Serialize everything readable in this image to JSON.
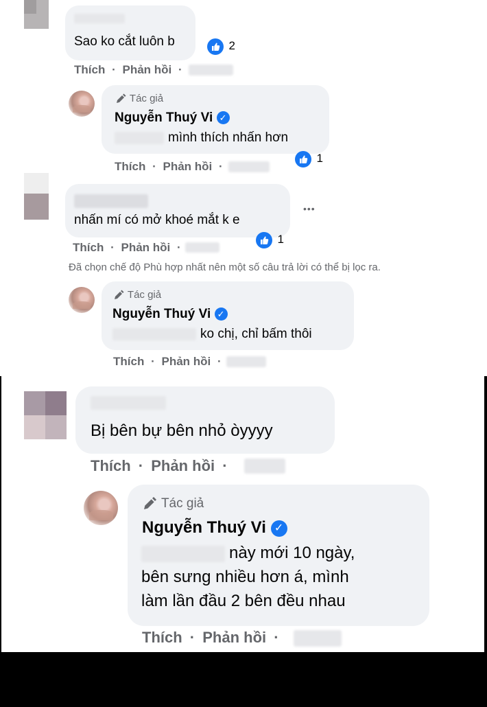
{
  "colors": {
    "like_blue": "#1877f2",
    "bubble_bg": "#f0f2f5",
    "meta_gray": "#65676b",
    "footer_black": "#000000"
  },
  "comments": [
    {
      "text": "Sao ko cắt luôn b",
      "likes": "2",
      "actions": {
        "like": "Thích",
        "reply": "Phản hồi"
      }
    },
    {
      "author_label": "Tác giả",
      "name": "Nguyễn Thuý Vi",
      "text": "mình thích nhấn hơn",
      "likes": "1",
      "actions": {
        "like": "Thích",
        "reply": "Phản hồi"
      }
    },
    {
      "text": "nhấn mí có mở khoé mắt k e",
      "likes": "1",
      "more": "•••",
      "actions": {
        "like": "Thích",
        "reply": "Phản hồi"
      }
    },
    {
      "author_label": "Tác giả",
      "name": "Nguyễn Thuý Vi",
      "text": "ko chị, chỉ bấm thôi",
      "actions": {
        "like": "Thích",
        "reply": "Phản hồi"
      }
    },
    {
      "text": "Bị bên bự bên nhỏ òyyyy",
      "actions": {
        "like": "Thích",
        "reply": "Phản hồi"
      }
    },
    {
      "author_label": "Tác giả",
      "name": "Nguyễn Thuý Vi",
      "text_lines": [
        "này mới 10 ngày,",
        "bên sưng nhiều hơn á, mình",
        "làm lần đầu 2 bên đều nhau"
      ],
      "actions": {
        "like": "Thích",
        "reply": "Phản hồi"
      }
    }
  ],
  "filter_notice": "Đã chọn chế độ Phù hợp nhất nên một số câu trả lời có thể bị lọc ra.",
  "separator": "·",
  "icons": {
    "like": "thumbs-up-icon",
    "pen": "pen-icon",
    "verified": "verified-badge-icon",
    "more": "more-options-icon"
  }
}
